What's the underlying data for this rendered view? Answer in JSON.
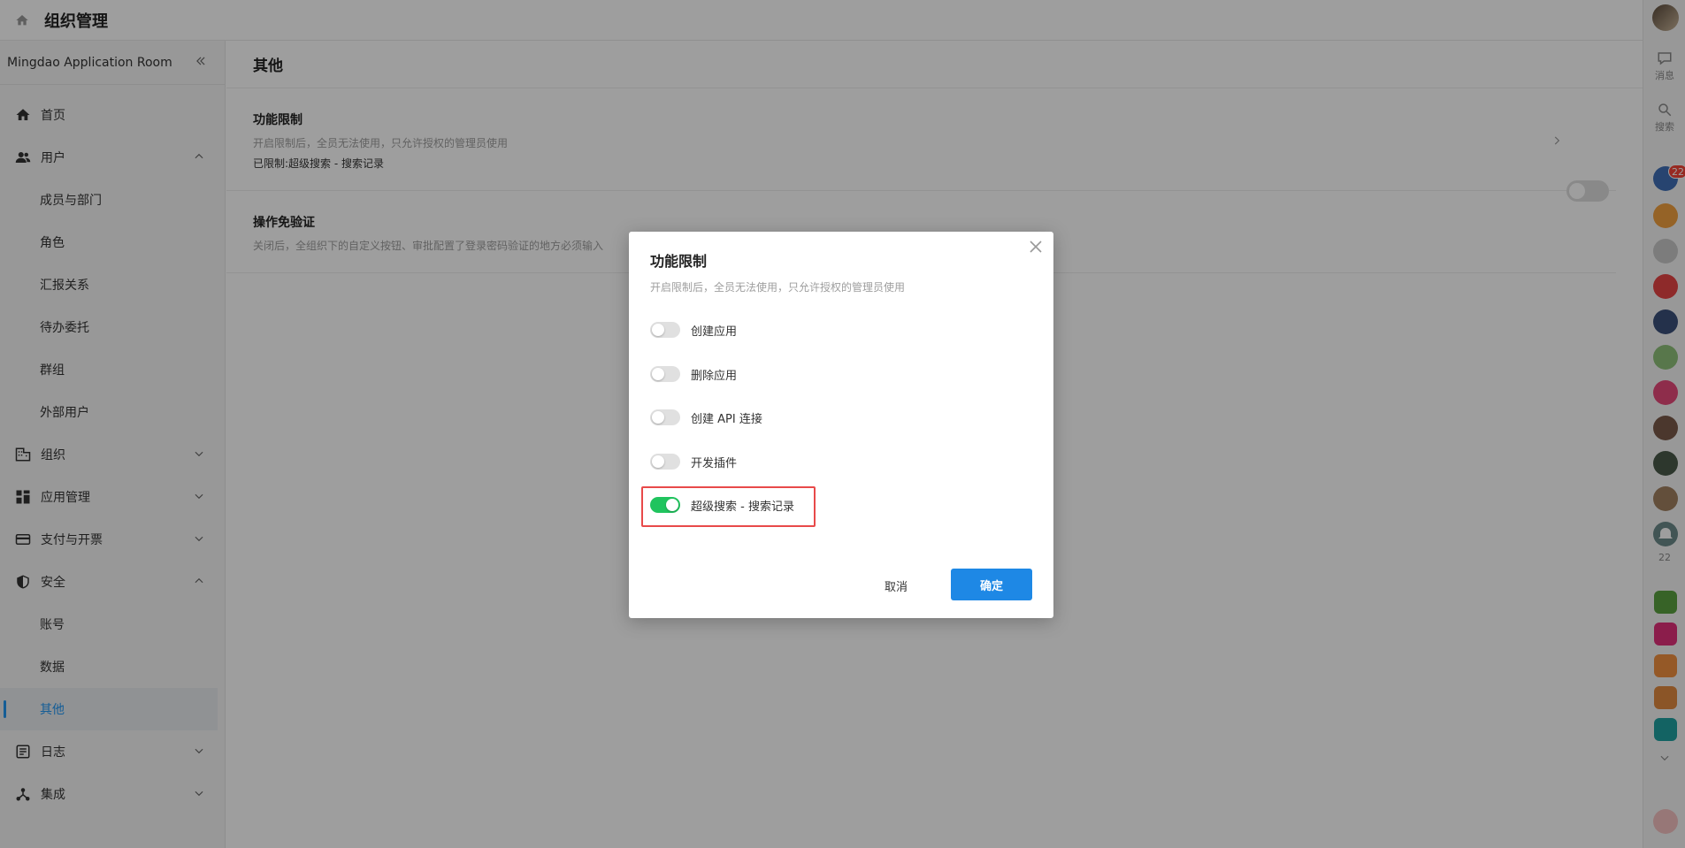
{
  "header": {
    "title": "组织管理"
  },
  "sidebar": {
    "org_name": "Mingdao Application Room",
    "items": [
      {
        "label": "首页"
      },
      {
        "label": "用户"
      },
      {
        "label": "成员与部门"
      },
      {
        "label": "角色"
      },
      {
        "label": "汇报关系"
      },
      {
        "label": "待办委托"
      },
      {
        "label": "群组"
      },
      {
        "label": "外部用户"
      },
      {
        "label": "组织"
      },
      {
        "label": "应用管理"
      },
      {
        "label": "支付与开票"
      },
      {
        "label": "安全"
      },
      {
        "label": "账号"
      },
      {
        "label": "数据"
      },
      {
        "label": "其他"
      },
      {
        "label": "日志"
      },
      {
        "label": "集成"
      }
    ]
  },
  "main": {
    "title": "其他",
    "settings": [
      {
        "title": "功能限制",
        "desc": "开启限制后，全员无法使用，只允许授权的管理员使用",
        "extra": "已限制:超级搜索 - 搜索记录"
      },
      {
        "title": "操作免验证",
        "desc": "关闭后，全组织下的自定义按钮、审批配置了登录密码验证的地方必须输入"
      }
    ]
  },
  "rail": {
    "messages_label": "消息",
    "search_label": "搜索",
    "badge_count": "22",
    "bell_count": "22"
  },
  "modal": {
    "title": "功能限制",
    "desc": "开启限制后，全员无法使用，只允许授权的管理员使用",
    "options": [
      {
        "label": "创建应用",
        "on": false
      },
      {
        "label": "删除应用",
        "on": false
      },
      {
        "label": "创建 API 连接",
        "on": false
      },
      {
        "label": "开发插件",
        "on": false
      },
      {
        "label": "超级搜索 - 搜索记录",
        "on": true
      }
    ],
    "cancel_label": "取消",
    "ok_label": "确定"
  },
  "colors": {
    "accent": "#1e88e5",
    "toggle_on": "#20c45e",
    "highlight": "#e84a4a"
  }
}
